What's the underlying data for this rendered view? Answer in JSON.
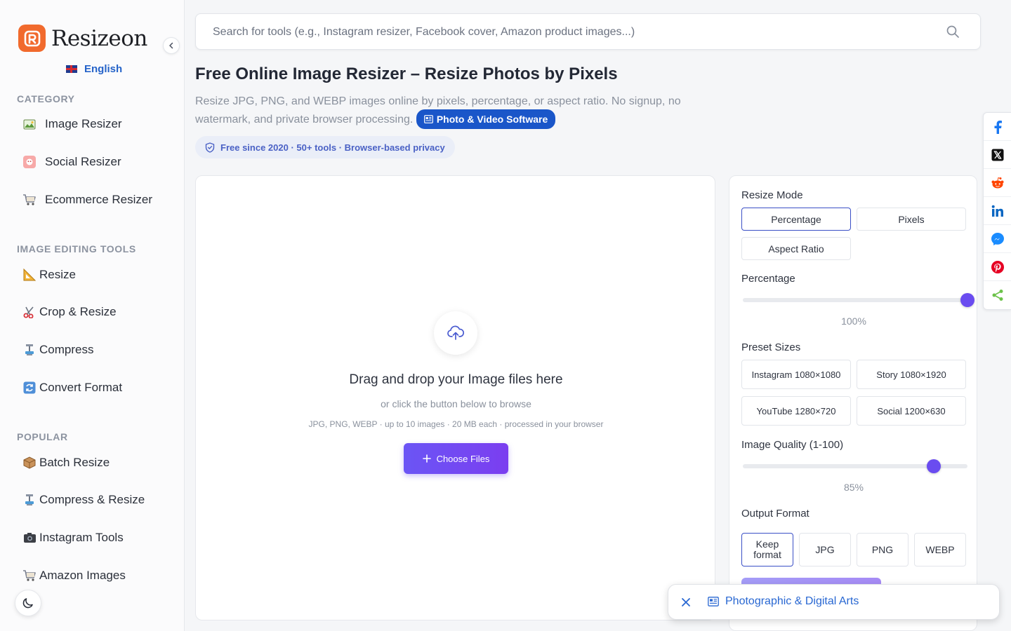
{
  "brand": {
    "name": "Resizeon",
    "accent": "#f16a2d"
  },
  "language": {
    "label": "English"
  },
  "sidebar": {
    "sections": [
      {
        "title": "CATEGORY",
        "items": [
          {
            "label": "Image Resizer",
            "icon": "landscape-icon"
          },
          {
            "label": "Social Resizer",
            "icon": "social-icon"
          },
          {
            "label": "Ecommerce Resizer",
            "icon": "cart-icon"
          }
        ]
      },
      {
        "title": "IMAGE EDITING TOOLS",
        "items": [
          {
            "label": "Resize",
            "icon": "triangle-ruler-icon"
          },
          {
            "label": "Crop & Resize",
            "icon": "scissors-icon"
          },
          {
            "label": "Compress",
            "icon": "clamp-icon"
          },
          {
            "label": "Convert Format",
            "icon": "refresh-icon"
          }
        ]
      },
      {
        "title": "POPULAR",
        "items": [
          {
            "label": "Batch Resize",
            "icon": "package-icon"
          },
          {
            "label": "Compress & Resize",
            "icon": "clamp-icon"
          },
          {
            "label": "Instagram Tools",
            "icon": "camera-icon"
          },
          {
            "label": "Amazon Images",
            "icon": "cart-icon"
          }
        ]
      }
    ]
  },
  "search": {
    "placeholder": "Search for tools (e.g., Instagram resizer, Facebook cover, Amazon product images...)"
  },
  "page": {
    "title": "Free Online Image Resizer – Resize Photos by Pixels",
    "description": "Resize JPG, PNG, and WEBP images online by pixels, percentage, or aspect ratio. No signup, no watermark, and private browser processing.",
    "category_badge": "Photo & Video Software",
    "trust_badge": "Free since 2020 · 50+ tools · Browser-based privacy"
  },
  "upload": {
    "title": "Drag and drop your Image files here",
    "subtitle": "or click the button below to browse",
    "meta": "JPG, PNG, WEBP · up to 10 images · 20 MB each · processed in your browser",
    "button_label": "Choose Files"
  },
  "settings": {
    "resize_mode_label": "Resize Mode",
    "modes": [
      "Percentage",
      "Pixels",
      "Aspect Ratio"
    ],
    "active_mode": "Percentage",
    "percentage_label": "Percentage",
    "percentage_value": 100,
    "percentage_display": "100%",
    "preset_label": "Preset Sizes",
    "presets": [
      "Instagram 1080×1080",
      "Story 1080×1920",
      "YouTube 1280×720",
      "Social 1200×630"
    ],
    "quality_label": "Image Quality (1-100)",
    "quality_value": 85,
    "quality_display": "85%",
    "output_label": "Output Format",
    "formats": [
      "Keep format",
      "JPG",
      "PNG",
      "WEBP"
    ],
    "active_format": "Keep format"
  },
  "share": {
    "buttons": [
      "facebook-icon",
      "x-icon",
      "reddit-icon",
      "linkedin-icon",
      "messenger-icon",
      "pinterest-icon",
      "share-icon"
    ]
  },
  "toast": {
    "link_label": "Photographic & Digital Arts"
  },
  "colors": {
    "primary": "#6b55f5",
    "link": "#2563c9",
    "badge": "#1a56c9"
  }
}
